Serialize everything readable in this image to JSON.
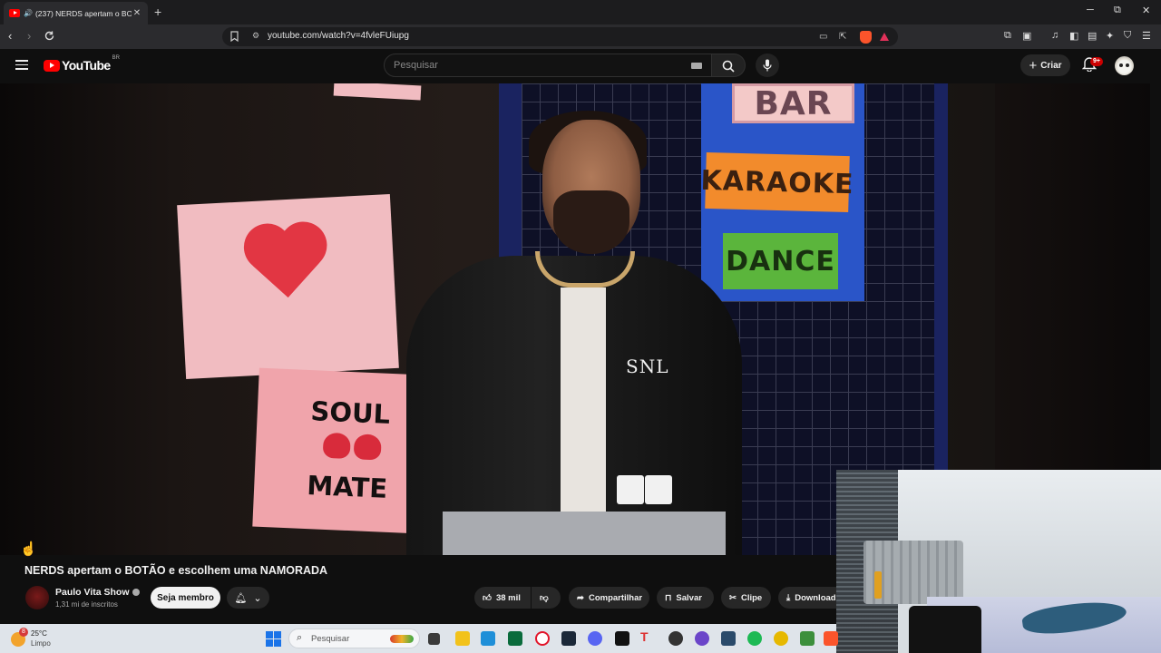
{
  "browser": {
    "tab_title": "(237) NERDS apertam o BOTÃO e escolhem uma NAMORADA",
    "tab_close": "✕",
    "new_tab": "+",
    "url": "youtube.com/watch?v=4fvleFUiupg",
    "window_controls": {
      "minimize": "─",
      "restore": "⧉",
      "close": "✕"
    }
  },
  "youtube": {
    "logo_text": "YouTube",
    "country_code": "BR",
    "search_placeholder": "Pesquisar",
    "create_label": "Criar",
    "notification_badge": "9+"
  },
  "video_signs": {
    "bar": "BAR",
    "karaoke": "KARAOKE",
    "dance": "DANCE",
    "soul": "SOUL",
    "mate": "MATE",
    "jacket_logo": "SNL"
  },
  "video": {
    "title": "NERDS apertam o BOTÃO e escolhem uma NAMORADA",
    "channel_name": "Paulo Vita Show",
    "subscribers": "1,31 mi de inscritos",
    "member_button": "Seja membro",
    "likes": "38 mil",
    "share_label": "Compartilhar",
    "save_label": "Salvar",
    "clip_label": "Clipe",
    "download_label": "Download"
  },
  "taskbar": {
    "temperature": "25°C",
    "condition": "Limpo",
    "weather_badge": "8",
    "search_placeholder": "Pesquisar"
  },
  "colors": {
    "youtube_red": "#ff0000",
    "brave_orange": "#fb542b",
    "background": "#0f0f0f"
  }
}
